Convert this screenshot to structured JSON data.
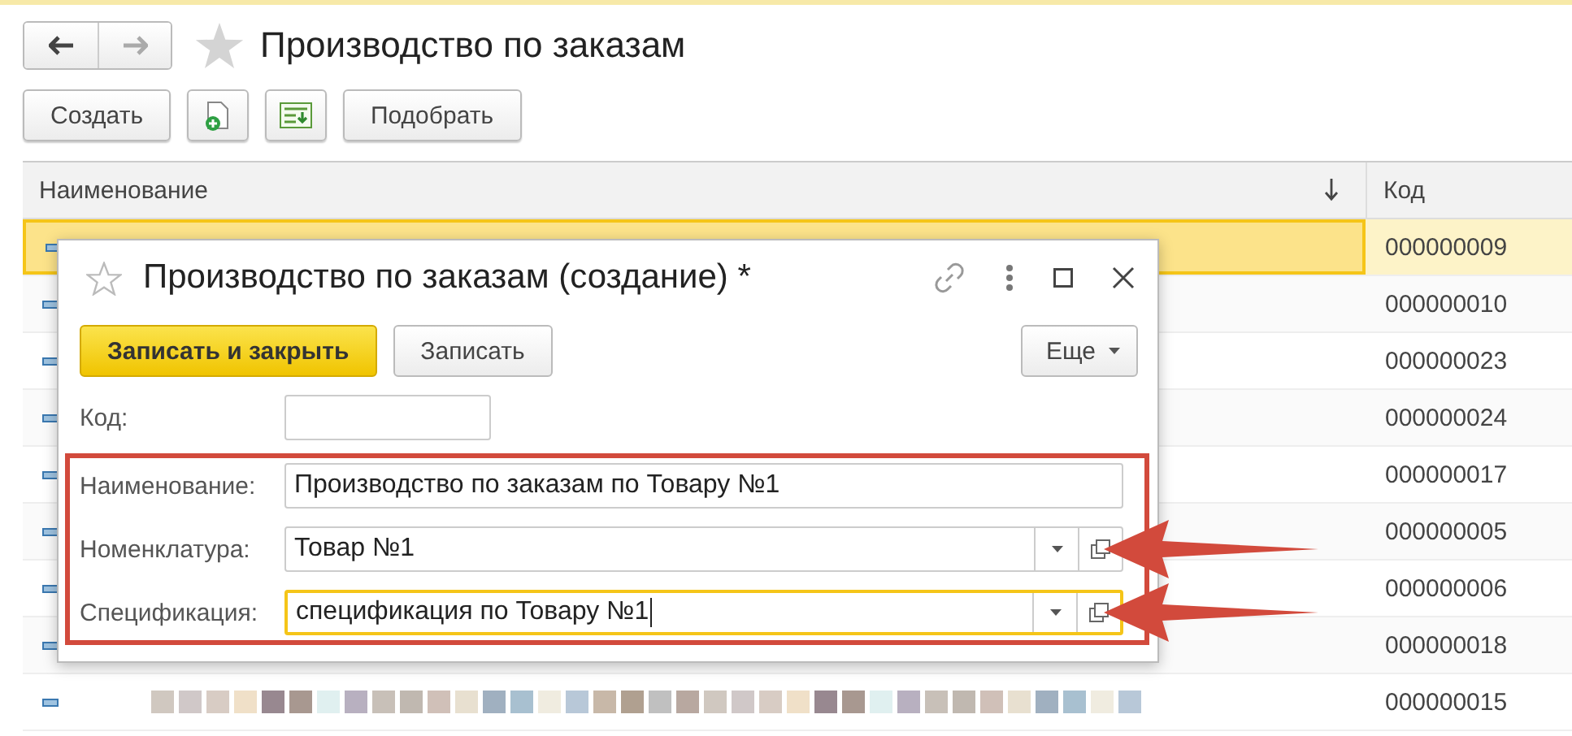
{
  "page": {
    "title": "Производство по заказам",
    "favorite": false
  },
  "toolbar": [
    {
      "kind": "text",
      "label": "Создать"
    },
    {
      "kind": "add-icon"
    },
    {
      "kind": "list-icon"
    },
    {
      "kind": "text",
      "label": "Подобрать"
    }
  ],
  "table": {
    "columns": [
      {
        "label": "Наименование",
        "sorted": true
      },
      {
        "label": "Код",
        "sorted": false
      }
    ],
    "rows": [
      {
        "code": "000000009",
        "selected": true
      },
      {
        "code": "000000010",
        "selected": false
      },
      {
        "code": "000000023",
        "selected": false
      },
      {
        "code": "000000024",
        "selected": false
      },
      {
        "code": "000000017",
        "selected": false
      },
      {
        "code": "000000005",
        "selected": false
      },
      {
        "code": "000000006",
        "selected": false
      },
      {
        "code": "000000018",
        "selected": false
      },
      {
        "code": "000000015",
        "selected": false,
        "blurred": true
      }
    ]
  },
  "dialog": {
    "title": "Производство по заказам (создание) *",
    "favorite": false,
    "buttons": [
      {
        "label": "Записать и закрыть",
        "default": true
      },
      {
        "label": "Записать",
        "default": false
      }
    ],
    "more": "Еще",
    "fields": [
      {
        "label": "Код:",
        "kind": "short"
      }
    ],
    "highlighted_fields": [
      {
        "label": "Наименование:",
        "value": "Производство по заказам по Товару №1",
        "kind": "text",
        "focused": false,
        "arrow": false
      },
      {
        "label": "Номенклатура:",
        "value": "Товар №1",
        "kind": "select",
        "focused": false,
        "arrow": true
      },
      {
        "label": "Спецификация:",
        "value": "спецификация по Товару №1",
        "kind": "select",
        "focused": true,
        "arrow": true
      }
    ]
  }
}
